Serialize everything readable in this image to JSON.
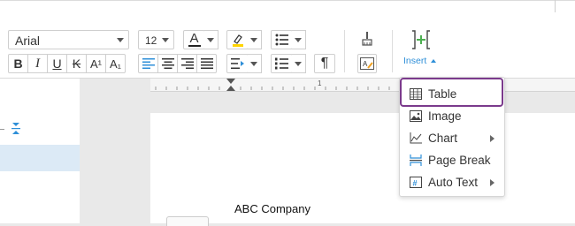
{
  "toolbar": {
    "font_family": "Arial",
    "font_size": "12",
    "bold": "B",
    "italic": "I",
    "underline": "U",
    "strikethrough": "K",
    "superscript": "A¹",
    "subscript": "A₁",
    "font_color": "A",
    "insert_label": "Insert",
    "paragraph_mark": "¶",
    "accent_color": "#2e8fd8",
    "insert_plus_color": "#4caf50",
    "highlight_color": "#ffd400",
    "font_color_bar": "#d9534f"
  },
  "ruler": {
    "mark": "1"
  },
  "insert_menu": {
    "items": [
      {
        "label": "Table",
        "icon": "table-icon",
        "submenu": false
      },
      {
        "label": "Image",
        "icon": "image-icon",
        "submenu": false
      },
      {
        "label": "Chart",
        "icon": "chart-icon",
        "submenu": true
      },
      {
        "label": "Page Break",
        "icon": "page-break-icon",
        "submenu": false
      },
      {
        "label": "Auto Text",
        "icon": "auto-text-icon",
        "submenu": true
      }
    ],
    "highlight_color": "#7b3a8c"
  },
  "document": {
    "line1": "ABC Company"
  }
}
